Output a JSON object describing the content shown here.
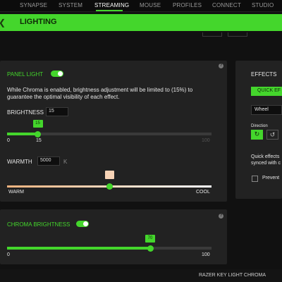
{
  "nav": {
    "tabs": [
      {
        "label": "SYNAPSE"
      },
      {
        "label": "SYSTEM"
      },
      {
        "label": "STREAMING"
      },
      {
        "label": "MOUSE"
      },
      {
        "label": "PROFILES"
      },
      {
        "label": "CONNECT"
      },
      {
        "label": "STUDIO"
      }
    ],
    "active_tab": "STREAMING"
  },
  "header": {
    "title": "LIGHTING"
  },
  "panel_light": {
    "title": "PANEL LIGHT",
    "toggle_on": true,
    "notice": "While Chroma is enabled, brightness adjustment will be limited to (15%) to guarantee the optimal visibility of each effect.",
    "brightness": {
      "label": "BRIGHTNESS",
      "value": "15",
      "bubble": "15",
      "min_label": "0",
      "limit_label": "15",
      "max_label": "100",
      "fraction": 0.15
    },
    "warmth": {
      "label": "WARMTH",
      "value": "5000",
      "unit": "K",
      "warm_label": "WARM",
      "cool_label": "COOL",
      "fraction": 0.5
    }
  },
  "chroma_brightness": {
    "title": "CHROMA BRIGHTNESS",
    "toggle_on": true,
    "bubble": "70",
    "min_label": "0",
    "max_label": "100",
    "fraction": 0.7
  },
  "effects": {
    "title": "EFFECTS",
    "quick_button": "QUICK EF",
    "selected_effect": "Wheel",
    "direction_label": "Direction",
    "quick_note_line1": "Quick effects",
    "quick_note_line2": "synced with c",
    "prevent_label": "Prevent"
  },
  "footer": {
    "device": "RAZER KEY LIGHT CHROMA"
  },
  "colors": {
    "accent": "#44d62c",
    "background": "#111111",
    "panel": "#222222"
  },
  "icons": {
    "info": "info-icon",
    "header_chevron": "chevron-left-icon",
    "direction_cw": "rotate-clockwise-icon",
    "direction_ccw": "rotate-counterclockwise-icon"
  }
}
